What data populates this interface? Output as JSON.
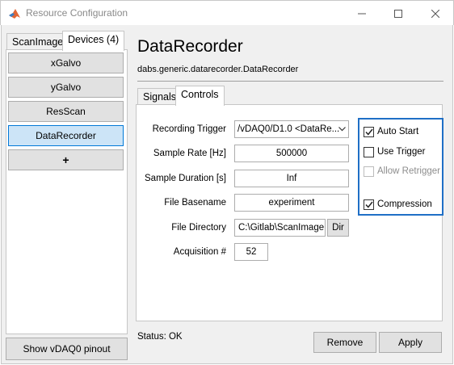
{
  "window": {
    "title": "Resource Configuration",
    "icon": "matlab-icon",
    "controls": [
      "minimize-icon",
      "maximize-icon",
      "close-icon"
    ]
  },
  "left_tabs": [
    {
      "label": "ScanImage",
      "active": false
    },
    {
      "label": "Devices (4)",
      "active": true
    }
  ],
  "devices": [
    {
      "label": "xGalvo",
      "selected": false
    },
    {
      "label": "yGalvo",
      "selected": false
    },
    {
      "label": "ResScan",
      "selected": false
    },
    {
      "label": "DataRecorder",
      "selected": true
    }
  ],
  "add_button_label": "+",
  "pinout_button_label": "Show vDAQ0 pinout",
  "device": {
    "title": "DataRecorder",
    "class_path": "dabs.generic.datarecorder.DataRecorder"
  },
  "right_tabs": [
    {
      "label": "Signals",
      "active": false
    },
    {
      "label": "Controls",
      "active": true
    }
  ],
  "fields": {
    "recording_trigger": {
      "label": "Recording Trigger",
      "value": "/vDAQ0/D1.0 <DataRe..."
    },
    "sample_rate": {
      "label": "Sample Rate [Hz]",
      "value": "500000"
    },
    "sample_duration": {
      "label": "Sample Duration [s]",
      "value": "Inf"
    },
    "file_basename": {
      "label": "File Basename",
      "value": "experiment"
    },
    "file_directory": {
      "label": "File Directory",
      "value": "C:\\Gitlab\\ScanImage"
    },
    "acquisition_number": {
      "label": "Acquisition #",
      "value": "52"
    }
  },
  "dir_button_label": "Dir",
  "checkboxes": {
    "auto_start": {
      "label": "Auto Start",
      "checked": true,
      "enabled": true
    },
    "use_trigger": {
      "label": "Use Trigger",
      "checked": false,
      "enabled": true
    },
    "allow_retrigger": {
      "label": "Allow Retrigger",
      "checked": false,
      "enabled": false
    },
    "compression": {
      "label": "Compression",
      "checked": true,
      "enabled": true
    }
  },
  "status_text": "Status: OK",
  "buttons": {
    "remove": "Remove",
    "apply": "Apply"
  },
  "colors": {
    "selection_bg": "#cce4f7",
    "selection_border": "#0078d7",
    "highlight_box": "#1f6fc6"
  }
}
